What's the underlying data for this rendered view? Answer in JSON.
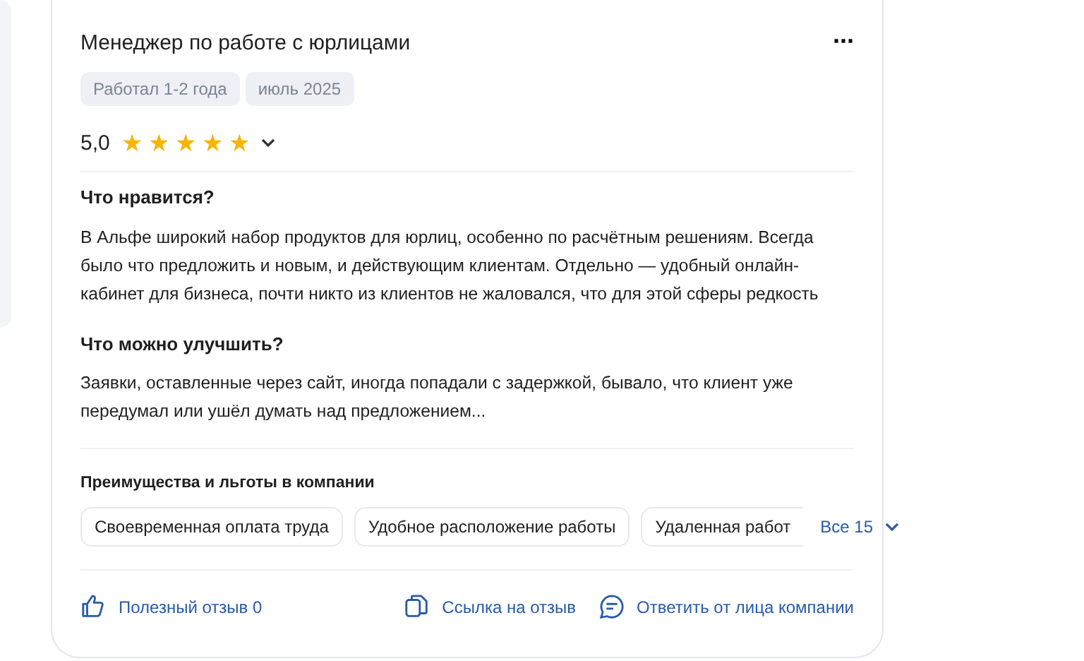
{
  "review": {
    "title": "Менеджер по работе с юрлицами",
    "more_button": "···",
    "tags": [
      "Работал 1-2 года",
      "июль 2025"
    ],
    "rating": {
      "value": "5,0",
      "stars": 5
    },
    "sections": [
      {
        "heading": "Что нравится?",
        "text": "В Альфе широкий набор продуктов для юрлиц, особенно по расчётным решениям. Всегда было что предложить и новым, и действующим клиентам. Отдельно — удобный онлайн-кабинет для бизнеса, почти никто из клиентов не жаловался, что для этой сферы редкость"
      },
      {
        "heading": "Что можно улучшить?",
        "text": "Заявки, оставленные через сайт, иногда попадали с задержкой, бывало, что клиент уже передумал или ушёл думать над предложением..."
      }
    ],
    "benefits": {
      "heading": "Преимущества и льготы в компании",
      "items": [
        "Своевременная оплата труда",
        "Удобное расположение работы",
        "Удаленная работ"
      ],
      "all_button": "Все 15"
    },
    "actions": [
      {
        "kind": "like",
        "label": "Полезный отзыв 0"
      },
      {
        "kind": "link",
        "label": "Ссылка на отзыв"
      },
      {
        "kind": "reply",
        "label": "Ответить от лица компании"
      }
    ]
  }
}
